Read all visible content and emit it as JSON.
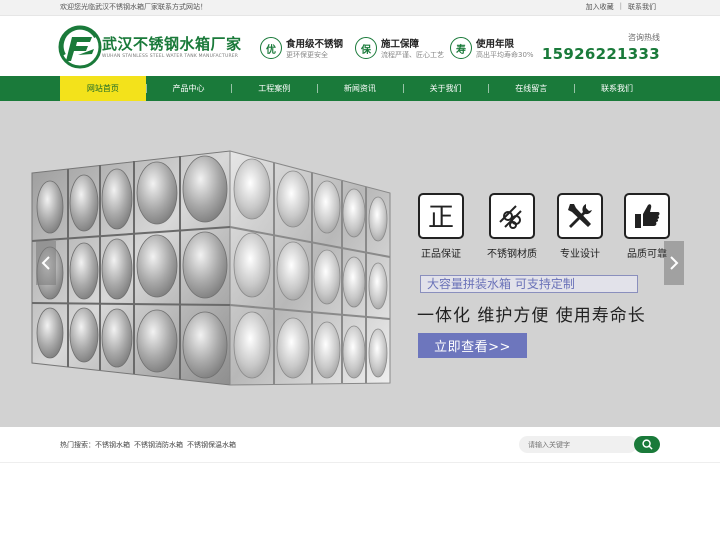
{
  "topbar": {
    "welcome": "欢迎您光临武汉不锈钢水箱厂家联系方式网站！",
    "add_favorite": "加入收藏",
    "separator": "|",
    "contact": "联系我们"
  },
  "header": {
    "logo_title": "武汉不锈钢水箱厂家",
    "logo_subtitle": "WUHAN STAINLESS STEEL WATER TANK MANUFACTURER",
    "features": [
      {
        "icon_char": "优",
        "title": "食用级不锈钢",
        "subtitle": "更环保更安全"
      },
      {
        "icon_char": "保",
        "title": "施工保障",
        "subtitle": "流程严谨、匠心工艺"
      },
      {
        "icon_char": "寿",
        "title": "使用年限",
        "subtitle": "高出平均寿命30%"
      }
    ],
    "hotline_label": "咨询热线",
    "hotline_number": "15926221333"
  },
  "nav": {
    "items": [
      "网站首页",
      "产品中心",
      "工程案例",
      "新闻资讯",
      "关于我们",
      "在线留言",
      "联系我们"
    ],
    "active_index": 0
  },
  "banner": {
    "icons": [
      {
        "label": "正品保证",
        "icon": "zheng-character-icon"
      },
      {
        "label": "不锈钢材质",
        "icon": "steel-pipes-icon"
      },
      {
        "label": "专业设计",
        "icon": "tools-icon"
      },
      {
        "label": "品质可靠",
        "icon": "thumbs-up-icon"
      }
    ],
    "tagline": "大容量拼装水箱 可支持定制",
    "slogan": "一体化 维护方便 使用寿命长",
    "cta": "立即查看>>",
    "prev_icon": "chevron-left-icon",
    "next_icon": "chevron-right-icon"
  },
  "search": {
    "hot_label": "热门搜索：",
    "hot_terms": [
      "不锈钢水箱",
      "不锈钢消防水箱",
      "不锈钢保温水箱"
    ],
    "placeholder": "请输入关键字",
    "button_icon": "search-icon"
  },
  "colors": {
    "brand_green": "#1a7a3a",
    "nav_active": "#f3e21b",
    "cta_blue": "#6d76bd",
    "banner_bg": "#d2d2d2"
  }
}
